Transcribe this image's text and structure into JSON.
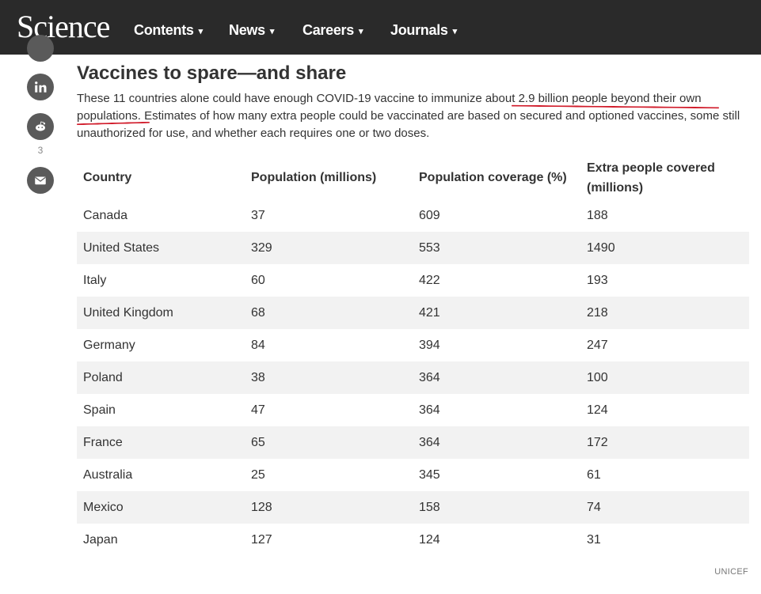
{
  "nav": {
    "logo": "Science",
    "items": [
      {
        "label": "Contents"
      },
      {
        "label": "News"
      },
      {
        "label": "Careers"
      },
      {
        "label": "Journals"
      }
    ],
    "caret": "⌄"
  },
  "share": {
    "reddit_count": "3"
  },
  "article": {
    "title": "Vaccines to spare—and share",
    "desc_part1": "These 11 countries alone could have enough COVID-19 vaccine to immunize about ",
    "desc_highlight": "2.9 billion people beyond their own populations.",
    "desc_part2": " Estimates of how many extra people could be vaccinated are based on secured and optioned vaccines, some still unauthorized for use, and whether each requires one or two doses."
  },
  "table": {
    "headers": [
      "Country",
      "Population (millions)",
      "Population coverage (%)",
      "Extra people covered (millions)"
    ],
    "rows": [
      [
        "Canada",
        "37",
        "609",
        "188"
      ],
      [
        "United States",
        "329",
        "553",
        "1490"
      ],
      [
        "Italy",
        "60",
        "422",
        "193"
      ],
      [
        "United Kingdom",
        "68",
        "421",
        "218"
      ],
      [
        "Germany",
        "84",
        "394",
        "247"
      ],
      [
        "Poland",
        "38",
        "364",
        "100"
      ],
      [
        "Spain",
        "47",
        "364",
        "124"
      ],
      [
        "France",
        "65",
        "364",
        "172"
      ],
      [
        "Australia",
        "25",
        "345",
        "61"
      ],
      [
        "Mexico",
        "128",
        "158",
        "74"
      ],
      [
        "Japan",
        "127",
        "124",
        "31"
      ]
    ]
  },
  "credit": "UNICEF",
  "colors": {
    "nav_bg": "#2a2a2a",
    "annotation_red": "#d11c2b",
    "stripe": "#f2f2f2"
  }
}
